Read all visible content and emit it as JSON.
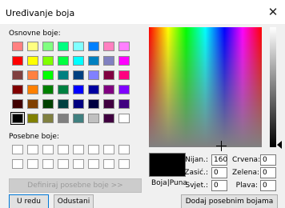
{
  "window": {
    "title": "Uređivanje boja",
    "close_glyph": "✕"
  },
  "basic_colors": {
    "label": "Osnovne boje:",
    "rows": [
      [
        "#ff8080",
        "#ffff80",
        "#80ff80",
        "#00ff80",
        "#80ffff",
        "#0080ff",
        "#ff80c0",
        "#ff80ff"
      ],
      [
        "#ff0000",
        "#ffff00",
        "#80ff00",
        "#00ff40",
        "#00ffff",
        "#0080c0",
        "#8080c0",
        "#ff00ff"
      ],
      [
        "#804040",
        "#ff8040",
        "#00ff00",
        "#008080",
        "#004080",
        "#8080ff",
        "#800040",
        "#ff0080"
      ],
      [
        "#800000",
        "#ff8000",
        "#008000",
        "#008040",
        "#0000ff",
        "#0000a0",
        "#800080",
        "#8000ff"
      ],
      [
        "#400000",
        "#804000",
        "#004000",
        "#004040",
        "#000080",
        "#000040",
        "#400040",
        "#400080"
      ],
      [
        "#000000",
        "#808000",
        "#808040",
        "#808080",
        "#408080",
        "#c0c0c0",
        "#400040",
        "#ffffff"
      ]
    ],
    "selected_row": 5,
    "selected_col": 0
  },
  "custom_colors": {
    "label": "Posebne boje:",
    "count": 16
  },
  "buttons": {
    "define_custom": "Definiraj posebne boje >>",
    "ok": "U redu",
    "cancel": "Odustani",
    "add_custom": "Dodaj posebnim bojama"
  },
  "preview": {
    "label": "Boja|Puna",
    "color": "#000000"
  },
  "fields": {
    "hue": {
      "label": "Nijan.:",
      "value": "160"
    },
    "saturation": {
      "label": "Zasić.:",
      "value": "0"
    },
    "luminance": {
      "label": "Svjet.:",
      "value": "0"
    },
    "red": {
      "label": "Crvena:",
      "value": "0"
    },
    "green": {
      "label": "Zelena:",
      "value": "0"
    },
    "blue": {
      "label": "Plava:",
      "value": "0"
    }
  }
}
